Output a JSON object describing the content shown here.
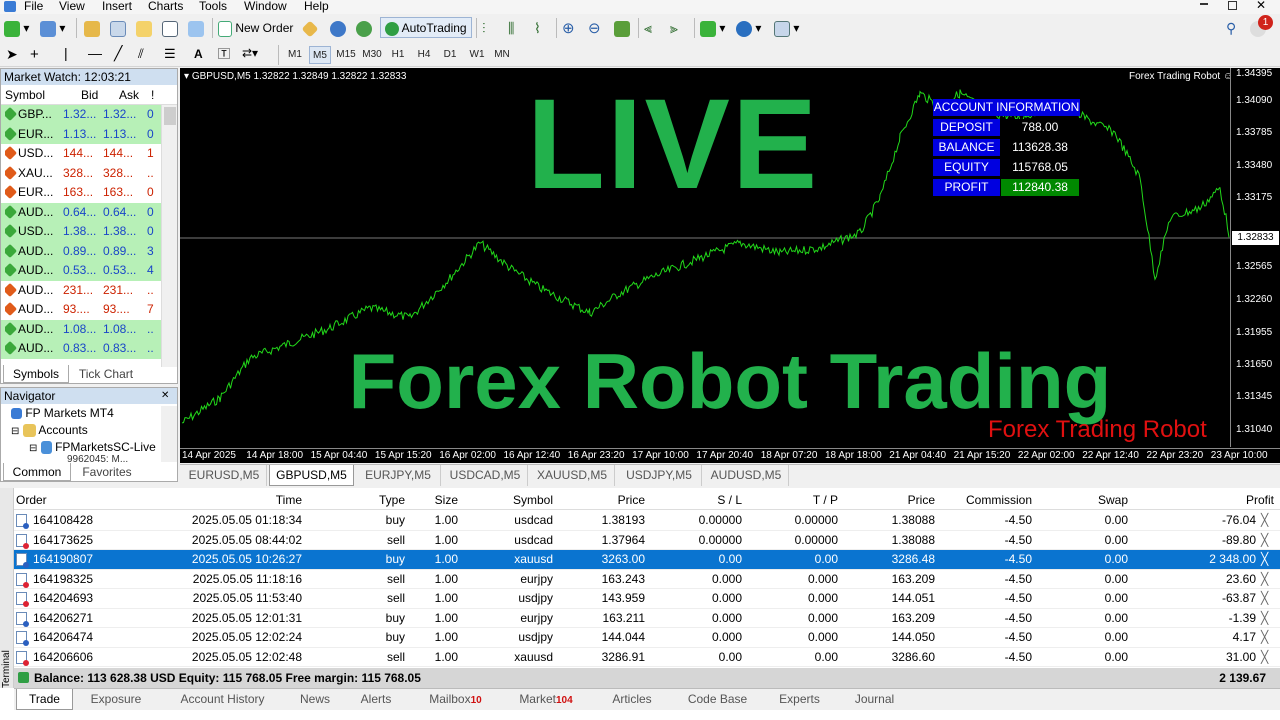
{
  "menu": [
    "File",
    "View",
    "Insert",
    "Charts",
    "Tools",
    "Window",
    "Help"
  ],
  "toolbar": {
    "new_order": "New Order",
    "autotrading": "AutoTrading",
    "timeframes": [
      "M1",
      "M5",
      "M15",
      "M30",
      "H1",
      "H4",
      "D1",
      "W1",
      "MN"
    ],
    "active_tf": "M5",
    "notif_count": "1"
  },
  "market_watch": {
    "title": "Market Watch: 12:03:21",
    "cols": [
      "Symbol",
      "Bid",
      "Ask",
      "!"
    ],
    "rows": [
      {
        "sym": "GBP...",
        "bid": "1.32...",
        "ask": "1.32...",
        "spr": "0",
        "dir": "up"
      },
      {
        "sym": "EUR...",
        "bid": "1.13...",
        "ask": "1.13...",
        "spr": "0",
        "dir": "up"
      },
      {
        "sym": "USD...",
        "bid": "144...",
        "ask": "144...",
        "spr": "1",
        "dir": "down"
      },
      {
        "sym": "XAU...",
        "bid": "328...",
        "ask": "328...",
        "spr": "..",
        "dir": "down"
      },
      {
        "sym": "EUR...",
        "bid": "163...",
        "ask": "163...",
        "spr": "0",
        "dir": "down"
      },
      {
        "sym": "AUD...",
        "bid": "0.64...",
        "ask": "0.64...",
        "spr": "0",
        "dir": "up"
      },
      {
        "sym": "USD...",
        "bid": "1.38...",
        "ask": "1.38...",
        "spr": "0",
        "dir": "up"
      },
      {
        "sym": "AUD...",
        "bid": "0.89...",
        "ask": "0.89...",
        "spr": "3",
        "dir": "up"
      },
      {
        "sym": "AUD...",
        "bid": "0.53...",
        "ask": "0.53...",
        "spr": "4",
        "dir": "up"
      },
      {
        "sym": "AUD...",
        "bid": "231...",
        "ask": "231...",
        "spr": "..",
        "dir": "down"
      },
      {
        "sym": "AUD...",
        "bid": "93....",
        "ask": "93....",
        "spr": "7",
        "dir": "down"
      },
      {
        "sym": "AUD...",
        "bid": "1.08...",
        "ask": "1.08...",
        "spr": "..",
        "dir": "up"
      },
      {
        "sym": "AUD...",
        "bid": "0.83...",
        "ask": "0.83...",
        "spr": "..",
        "dir": "up"
      }
    ],
    "tabs": [
      "Symbols",
      "Tick Chart"
    ]
  },
  "navigator": {
    "title": "Navigator",
    "items": [
      "FP Markets MT4",
      "Accounts",
      "FPMarketsSC-Live"
    ],
    "sub": "9962045: M...",
    "tabs": [
      "Common",
      "Favorites"
    ]
  },
  "chart": {
    "header": "GBPUSD,M5  1.32822 1.32849 1.32822 1.32833",
    "robot": "Forex Trading Robot",
    "overlay_live": "LIVE",
    "overlay_title": "Forex Robot Trading",
    "overlay_sub": "Forex Trading Robot",
    "price_labels": [
      "1.34395",
      "1.34090",
      "1.33785",
      "1.33480",
      "1.33175",
      "1.32833",
      "1.32565",
      "1.32260",
      "1.31955",
      "1.31650",
      "1.31345",
      "1.31040"
    ],
    "current_price": "1.32833",
    "time_labels": [
      "14 Apr 2025",
      "14 Apr 18:00",
      "15 Apr 04:40",
      "15 Apr 15:20",
      "16 Apr 02:00",
      "16 Apr 12:40",
      "16 Apr 23:20",
      "17 Apr 10:00",
      "17 Apr 20:40",
      "18 Apr 07:20",
      "18 Apr 18:00",
      "21 Apr 04:40",
      "21 Apr 15:20",
      "22 Apr 02:00",
      "22 Apr 12:40",
      "22 Apr 23:20",
      "23 Apr 10:00"
    ],
    "account": {
      "title": "ACCOUNT INFORMATION",
      "rows": [
        {
          "label": "DEPOSIT",
          "value": "788.00"
        },
        {
          "label": "BALANCE",
          "value": "113628.38"
        },
        {
          "label": "EQUITY",
          "value": "115768.05"
        },
        {
          "label": "PROFIT",
          "value": "112840.38"
        }
      ]
    },
    "colors": {
      "line": "#22d81a",
      "overlay": "#22b14c",
      "sub": "#e01010",
      "panel": "#0000e0"
    }
  },
  "chart_tabs": [
    "EURUSD,M5",
    "GBPUSD,M5",
    "EURJPY,M5",
    "USDCAD,M5",
    "XAUUSD,M5",
    "USDJPY,M5",
    "AUDUSD,M5"
  ],
  "active_chart_tab": "GBPUSD,M5",
  "terminal": {
    "side_label": "Terminal",
    "cols": [
      "Order",
      "Time",
      "Type",
      "Size",
      "Symbol",
      "Price",
      "S / L",
      "T / P",
      "Price",
      "Commission",
      "Swap",
      "Profit"
    ],
    "orders": [
      {
        "order": "164108428",
        "time": "2025.05.05 01:18:34",
        "type": "buy",
        "size": "1.00",
        "symbol": "usdcad",
        "price": "1.38193",
        "sl": "0.00000",
        "tp": "0.00000",
        "cur": "1.38088",
        "comm": "-4.50",
        "swap": "0.00",
        "profit": "-76.04"
      },
      {
        "order": "164173625",
        "time": "2025.05.05 08:44:02",
        "type": "sell",
        "size": "1.00",
        "symbol": "usdcad",
        "price": "1.37964",
        "sl": "0.00000",
        "tp": "0.00000",
        "cur": "1.38088",
        "comm": "-4.50",
        "swap": "0.00",
        "profit": "-89.80"
      },
      {
        "order": "164190807",
        "time": "2025.05.05 10:26:27",
        "type": "buy",
        "size": "1.00",
        "symbol": "xauusd",
        "price": "3263.00",
        "sl": "0.00",
        "tp": "0.00",
        "cur": "3286.48",
        "comm": "-4.50",
        "swap": "0.00",
        "profit": "2 348.00"
      },
      {
        "order": "164198325",
        "time": "2025.05.05 11:18:16",
        "type": "sell",
        "size": "1.00",
        "symbol": "eurjpy",
        "price": "163.243",
        "sl": "0.000",
        "tp": "0.000",
        "cur": "163.209",
        "comm": "-4.50",
        "swap": "0.00",
        "profit": "23.60"
      },
      {
        "order": "164204693",
        "time": "2025.05.05 11:53:40",
        "type": "sell",
        "size": "1.00",
        "symbol": "usdjpy",
        "price": "143.959",
        "sl": "0.000",
        "tp": "0.000",
        "cur": "144.051",
        "comm": "-4.50",
        "swap": "0.00",
        "profit": "-63.87"
      },
      {
        "order": "164206271",
        "time": "2025.05.05 12:01:31",
        "type": "buy",
        "size": "1.00",
        "symbol": "eurjpy",
        "price": "163.211",
        "sl": "0.000",
        "tp": "0.000",
        "cur": "163.209",
        "comm": "-4.50",
        "swap": "0.00",
        "profit": "-1.39"
      },
      {
        "order": "164206474",
        "time": "2025.05.05 12:02:24",
        "type": "buy",
        "size": "1.00",
        "symbol": "usdjpy",
        "price": "144.044",
        "sl": "0.000",
        "tp": "0.000",
        "cur": "144.050",
        "comm": "-4.50",
        "swap": "0.00",
        "profit": "4.17"
      },
      {
        "order": "164206606",
        "time": "2025.05.05 12:02:48",
        "type": "sell",
        "size": "1.00",
        "symbol": "xauusd",
        "price": "3286.91",
        "sl": "0.00",
        "tp": "0.00",
        "cur": "3286.60",
        "comm": "-4.50",
        "swap": "0.00",
        "profit": "31.00"
      }
    ],
    "selected_index": 2,
    "balance_line": "Balance: 113 628.38 USD  Equity: 115 768.05  Free margin: 115 768.05",
    "total_profit": "2 139.67",
    "tabs": [
      {
        "label": "Trade"
      },
      {
        "label": "Exposure"
      },
      {
        "label": "Account History"
      },
      {
        "label": "News"
      },
      {
        "label": "Alerts"
      },
      {
        "label": "Mailbox",
        "badge": "10"
      },
      {
        "label": "Market",
        "badge": "104"
      },
      {
        "label": "Articles"
      },
      {
        "label": "Code Base"
      },
      {
        "label": "Experts"
      },
      {
        "label": "Journal"
      }
    ]
  }
}
